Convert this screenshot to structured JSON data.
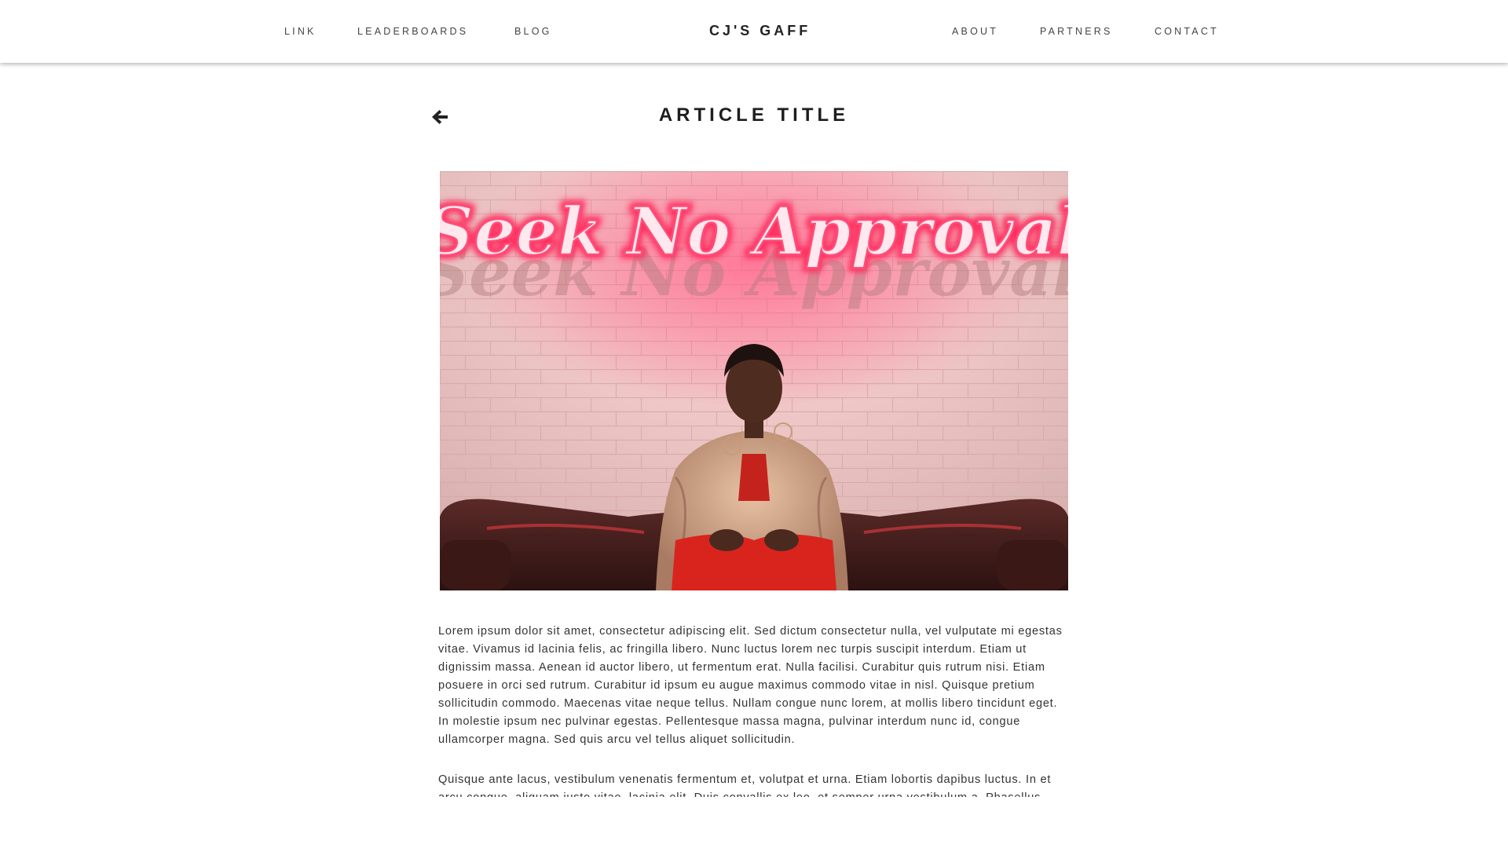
{
  "nav": {
    "left_links": [
      "LINK",
      "LEADERBOARDS",
      "BLOG"
    ],
    "brand": "CJ'S GAFF",
    "right_links": [
      "ABOUT",
      "PARTNERS",
      "CONTACT"
    ]
  },
  "article": {
    "back_icon": "arrow-left-icon",
    "title": "ARTICLE TITLE",
    "image": {
      "neon_text": "Seek No Approval",
      "neon_color": "#ff3d6a"
    },
    "paragraphs": [
      "Lorem ipsum dolor sit amet, consectetur adipiscing elit. Sed dictum consectetur nulla, vel vulputate mi egestas vitae. Vivamus id lacinia felis, ac fringilla libero. Nunc luctus lorem nec turpis suscipit interdum. Etiam ut dignissim massa. Aenean id auctor libero, ut fermentum erat. Nulla facilisi. Curabitur quis rutrum nisi. Etiam posuere in orci sed rutrum. Curabitur id ipsum eu augue maximus commodo vitae in nisl. Quisque pretium sollicitudin commodo. Maecenas vitae neque tellus. Nullam congue nunc lorem, at mollis libero tincidunt eget. In molestie ipsum nec pulvinar egestas. Pellentesque massa magna, pulvinar interdum nunc id, congue ullamcorper magna. Sed quis arcu vel tellus aliquet sollicitudin.",
      "Quisque ante lacus, vestibulum venenatis fermentum et, volutpat et urna. Etiam lobortis dapibus luctus. In et arcu congue, aliquam justo vitae, lacinia elit. Duis convallis ex leo, et semper urna vestibulum a. Phasellus"
    ]
  }
}
